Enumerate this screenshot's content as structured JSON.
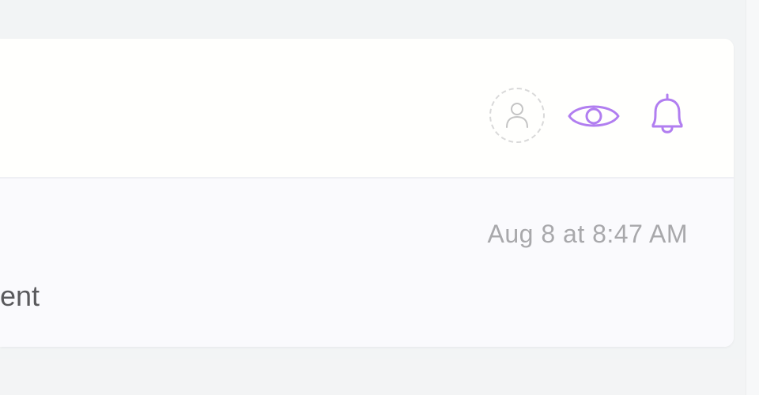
{
  "header": {
    "assignee_icon": "user-icon",
    "watch_icon": "eye-icon",
    "notify_icon": "bell-icon"
  },
  "comment": {
    "timestamp": "Aug 8 at 8:47 AM",
    "text_fragment": "ent"
  },
  "colors": {
    "accent": "#b17ef0",
    "muted_icon": "#c4c4c4",
    "timestamp": "#a8a8ab",
    "body_text": "#5a5a5d"
  }
}
